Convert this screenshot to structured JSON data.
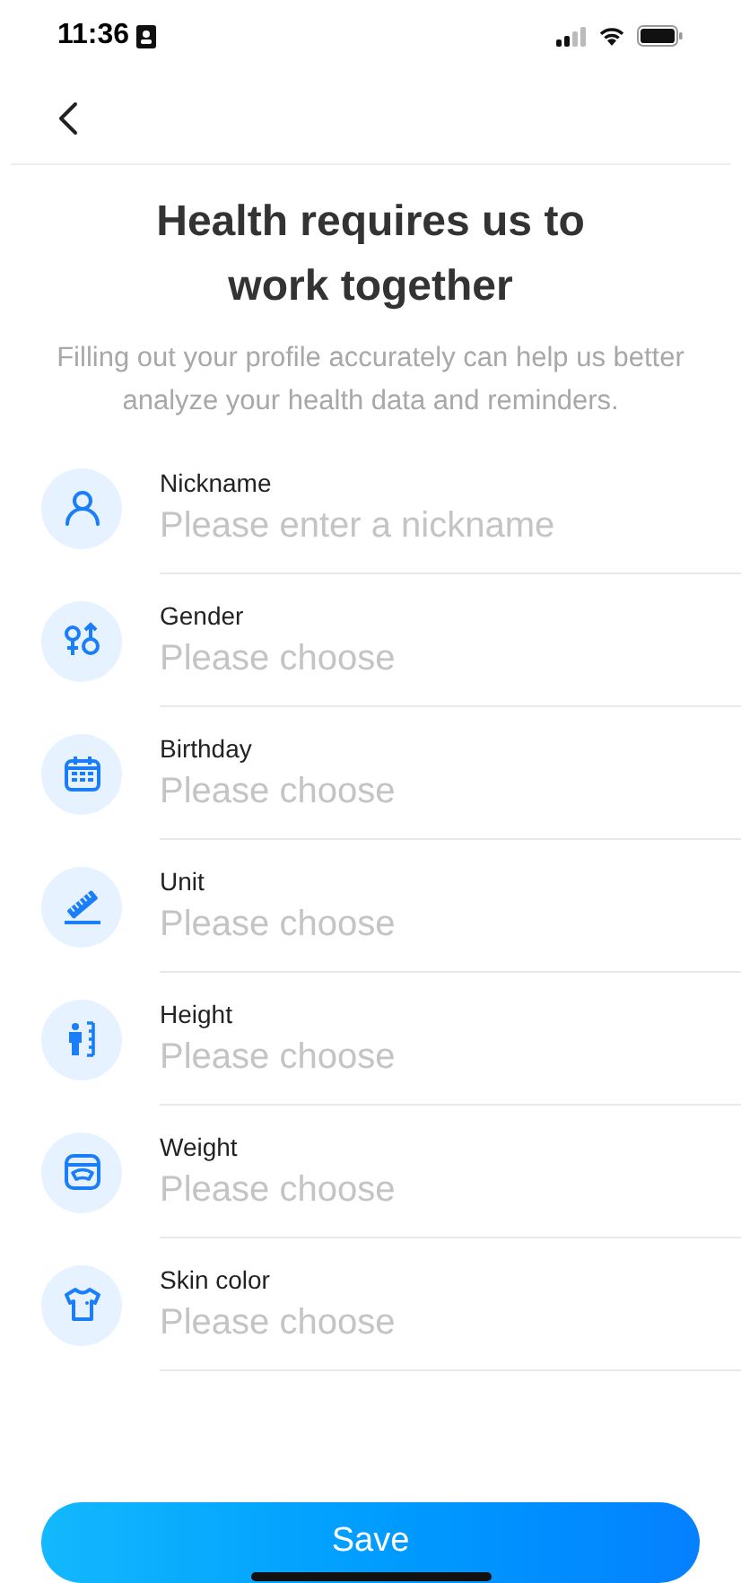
{
  "status_bar": {
    "time": "11:36"
  },
  "title": "Health requires us to work together",
  "subtitle": "Filling out your profile accurately can help us better analyze your health data and reminders.",
  "fields": [
    {
      "label": "Nickname",
      "placeholder": "Please enter a nickname"
    },
    {
      "label": "Gender",
      "placeholder": "Please choose"
    },
    {
      "label": "Birthday",
      "placeholder": "Please choose"
    },
    {
      "label": "Unit",
      "placeholder": "Please choose"
    },
    {
      "label": "Height",
      "placeholder": "Please choose"
    },
    {
      "label": "Weight",
      "placeholder": "Please choose"
    },
    {
      "label": "Skin color",
      "placeholder": "Please choose"
    }
  ],
  "save_button": "Save"
}
